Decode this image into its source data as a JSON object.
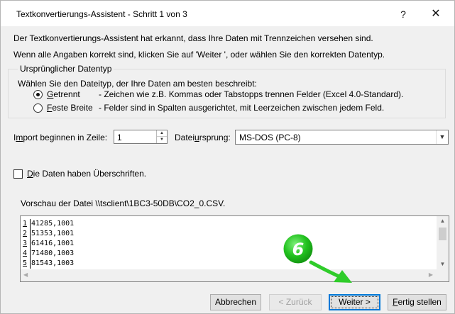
{
  "window": {
    "title": "Textkonvertierungs-Assistent - Schritt 1 von 3",
    "help_glyph": "?",
    "close_glyph": "✕"
  },
  "info": {
    "line1": "Der Textkonvertierungs-Assistent hat erkannt, dass Ihre Daten mit Trennzeichen versehen sind.",
    "line2": "Wenn alle Angaben korrekt sind, klicken Sie auf 'Weiter ', oder wählen Sie den korrekten Datentyp."
  },
  "datatype_group": {
    "title": "Ursprünglicher Datentyp",
    "description": "Wählen Sie den Dateityp, der Ihre Daten am besten beschreibt:",
    "options": [
      {
        "label_ul": "G",
        "label_rest": "etrennt",
        "desc": "- Zeichen wie z.B. Kommas oder Tabstopps trennen Felder (Excel 4.0-Standard).",
        "checked": true
      },
      {
        "label_ul": "F",
        "label_rest": "este Breite",
        "desc": "- Felder sind in Spalten ausgerichtet, mit Leerzeichen zwischen jedem Feld.",
        "checked": false
      }
    ]
  },
  "import_row": {
    "label_pre": "I",
    "label_ul": "m",
    "label_post": "port beginnen in Zeile:",
    "value": "1"
  },
  "origin": {
    "label_pre": "Datei",
    "label_ul": "u",
    "label_post": "rsprung:",
    "value": "MS-DOS (PC-8)"
  },
  "headers_checkbox": {
    "label_ul": "D",
    "label_rest": "ie Daten haben Überschriften.",
    "checked": false
  },
  "preview": {
    "label": "Vorschau der Datei \\\\tsclient\\1BC3-50DB\\CO2_0.CSV.",
    "lines": [
      {
        "n": "1",
        "text": "41285,1001"
      },
      {
        "n": "2",
        "text": "51353,1001"
      },
      {
        "n": "3",
        "text": "61416,1001"
      },
      {
        "n": "4",
        "text": "71480,1003"
      },
      {
        "n": "5",
        "text": "81543,1003"
      }
    ]
  },
  "buttons": {
    "cancel": "Abbrechen",
    "back": "< Zurück",
    "next": "Weiter >",
    "finish_ul": "F",
    "finish_rest": "ertig stellen"
  },
  "annotation": {
    "number": "6",
    "badge_color": "#22c21f",
    "arrow_color": "#2fcc2a"
  },
  "colors": {
    "dialog_bg": "#f0f0f0",
    "focus_border": "#0078d7"
  }
}
